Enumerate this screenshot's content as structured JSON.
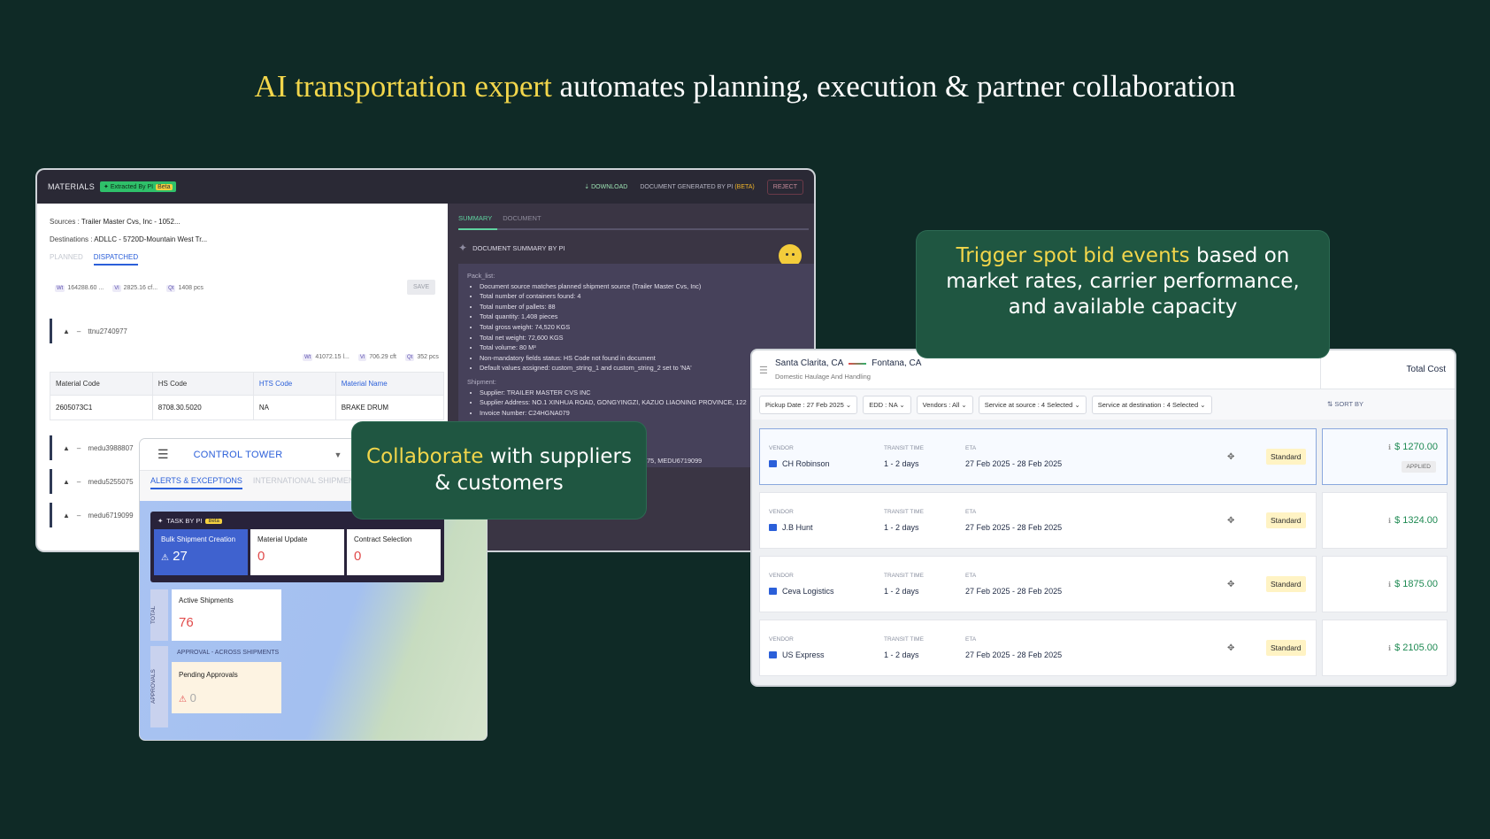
{
  "headline": {
    "accent": "AI transportation expert",
    "rest": " automates planning, execution & partner collaboration"
  },
  "materials_panel": {
    "title": "MATERIALS",
    "extracted_tag": "✦ Extracted By PI",
    "extracted_beta": "Beta",
    "download_label": "DOWNLOAD",
    "doc_generated_label": "DOCUMENT GENERATED BY PI",
    "doc_generated_beta": "(BETA)",
    "reject_label": "REJECT",
    "sources_label": "Sources :",
    "sources_value": "Trailer Master Cvs, Inc - 1052...",
    "destinations_label": "Destinations :",
    "destinations_value": "ADLLC - 5720D-Mountain West Tr...",
    "tab_planned": "PLANNED",
    "tab_dispatched": "DISPATCHED",
    "stats": [
      {
        "chip": "Wt",
        "value": "164288.60 ..."
      },
      {
        "chip": "Vl",
        "value": "2825.16 cf..."
      },
      {
        "chip": "Qt",
        "value": "1408 pcs"
      }
    ],
    "save_label": "SAVE",
    "container_1": "ttnu2740977",
    "mini_stats": [
      {
        "chip": "Wt",
        "value": "41072.15 l..."
      },
      {
        "chip": "Vl",
        "value": "706.29 cft"
      },
      {
        "chip": "Qt",
        "value": "352 pcs"
      }
    ],
    "table": {
      "headers": [
        "Material Code",
        "HS Code",
        "HTS Code",
        "Material Name"
      ],
      "row": [
        "2605073C1",
        "8708.30.5020",
        "NA",
        "BRAKE DRUM"
      ]
    },
    "containers": [
      "medu3988807",
      "medu5255075",
      "medu6719099"
    ],
    "summary_tab": "SUMMARY",
    "document_tab": "DOCUMENT",
    "summary_title": "DOCUMENT SUMMARY BY PI",
    "pack_list_label": "Pack_list:",
    "pack_list": [
      "Document source matches planned shipment source (Trailer Master Cvs, Inc)",
      "Total number of containers found: 4",
      "Total number of pallets: 88",
      "Total quantity: 1,408 pieces",
      "Total gross weight: 74,520 KGS",
      "Total net weight: 72,600 KGS",
      "Total volume: 80 M³",
      "Non-mandatory fields status: HS Code not found in document",
      "Default values assigned: custom_string_1 and custom_string_2 set to 'NA'"
    ],
    "shipment_label": "Shipment:",
    "shipment": [
      "Supplier: TRAILER MASTER CVS INC",
      "Supplier Address: NO.1 XINHUA ROAD, GONGYINGZI, KAZUO LIAONING PROVINCE, 122",
      "Invoice Number: C24HGNA079"
    ],
    "summary_tail": "5075, MEDU6719099"
  },
  "control_tower": {
    "title": "CONTROL TOWER",
    "tab_alerts": "ALERTS & EXCEPTIONS",
    "tab_international": "INTERNATIONAL SHIPMEN",
    "task_title": "TASK BY PI",
    "task_beta": "Beta",
    "tasks": [
      {
        "label": "Bulk Shipment Creation",
        "value": "27"
      },
      {
        "label": "Material Update",
        "value": "0"
      },
      {
        "label": "Contract Selection",
        "value": "0"
      }
    ],
    "total_tag": "TOTAL",
    "active_label": "Active Shipments",
    "active_value": "76",
    "approvals_tag": "APPROVALS",
    "approval_heading": "APPROVAL - ACROSS SHIPMENTS",
    "pending_label": "Pending Approvals",
    "pending_value": "0"
  },
  "callout_collab": {
    "accent": "Collaborate",
    "rest": " with suppliers & customers"
  },
  "callout_bid": {
    "accent": "Trigger spot bid events",
    "rest": " based on market rates, carrier performance, and available capacity"
  },
  "bids_panel": {
    "origin": "Santa Clarita, CA",
    "destination": "Fontana, CA",
    "subtitle": "Domestic Haulage And Handling",
    "total_cost_label": "Total Cost",
    "filters": [
      "Pickup Date : 27 Feb 2025 ⌄",
      "EDD : NA ⌄",
      "Vendors : All ⌄",
      "Service at source : 4 Selected ⌄",
      "Service at destination : 4 Selected ⌄"
    ],
    "sort_by": "⇅ SORT BY",
    "col_vendor": "VENDOR",
    "col_transit": "TRANSIT TIME",
    "col_eta": "ETA",
    "applied_label": "APPLIED",
    "vendors": [
      {
        "name": "CH Robinson",
        "transit": "1 - 2 days",
        "eta": "27 Feb 2025 - 28 Feb 2025",
        "service": "Standard",
        "price": "$ 1270.00"
      },
      {
        "name": "J.B Hunt",
        "transit": "1 - 2 days",
        "eta": "27 Feb 2025 - 28 Feb 2025",
        "service": "Standard",
        "price": "$ 1324.00"
      },
      {
        "name": "Ceva Logistics",
        "transit": "1 - 2 days",
        "eta": "27 Feb 2025 - 28 Feb 2025",
        "service": "Standard",
        "price": "$ 1875.00"
      },
      {
        "name": "US Express",
        "transit": "1 - 2 days",
        "eta": "27 Feb 2025 - 28 Feb 2025",
        "service": "Standard",
        "price": "$ 2105.00"
      }
    ]
  }
}
